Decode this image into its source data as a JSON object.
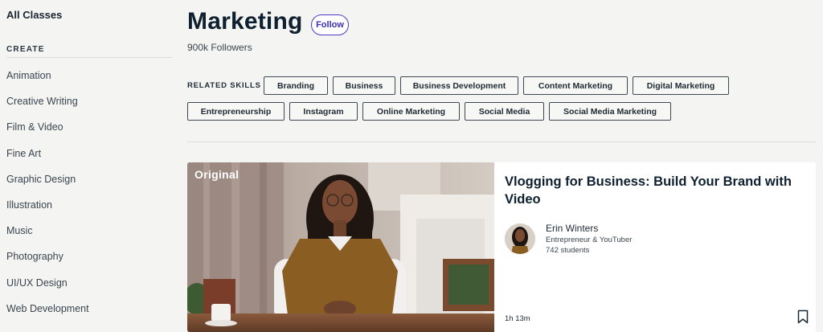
{
  "sidebar": {
    "all_classes": "All Classes",
    "section_heading": "CREATE",
    "items": [
      {
        "label": "Animation"
      },
      {
        "label": "Creative Writing"
      },
      {
        "label": "Film & Video"
      },
      {
        "label": "Fine Art"
      },
      {
        "label": "Graphic Design"
      },
      {
        "label": "Illustration"
      },
      {
        "label": "Music"
      },
      {
        "label": "Photography"
      },
      {
        "label": "UI/UX Design"
      },
      {
        "label": "Web Development"
      }
    ]
  },
  "header": {
    "title": "Marketing",
    "follow_label": "Follow",
    "followers": "900k Followers"
  },
  "skills": {
    "label": "RELATED SKILLS",
    "items": [
      "Branding",
      "Business",
      "Business Development",
      "Content Marketing",
      "Digital Marketing",
      "Entrepreneurship",
      "Instagram",
      "Online Marketing",
      "Social Media",
      "Social Media Marketing"
    ]
  },
  "course": {
    "badge": "Original",
    "title": "Vlogging for Business: Build Your Brand with Video",
    "teacher_name": "Erin Winters",
    "teacher_role": "Entrepreneur & YouTuber",
    "students": "742 students",
    "duration": "1h 13m",
    "bookmark_icon": "bookmark-icon"
  },
  "colors": {
    "accent": "#4b3fc7",
    "background": "#f4f4f2",
    "text": "#0f2030"
  }
}
